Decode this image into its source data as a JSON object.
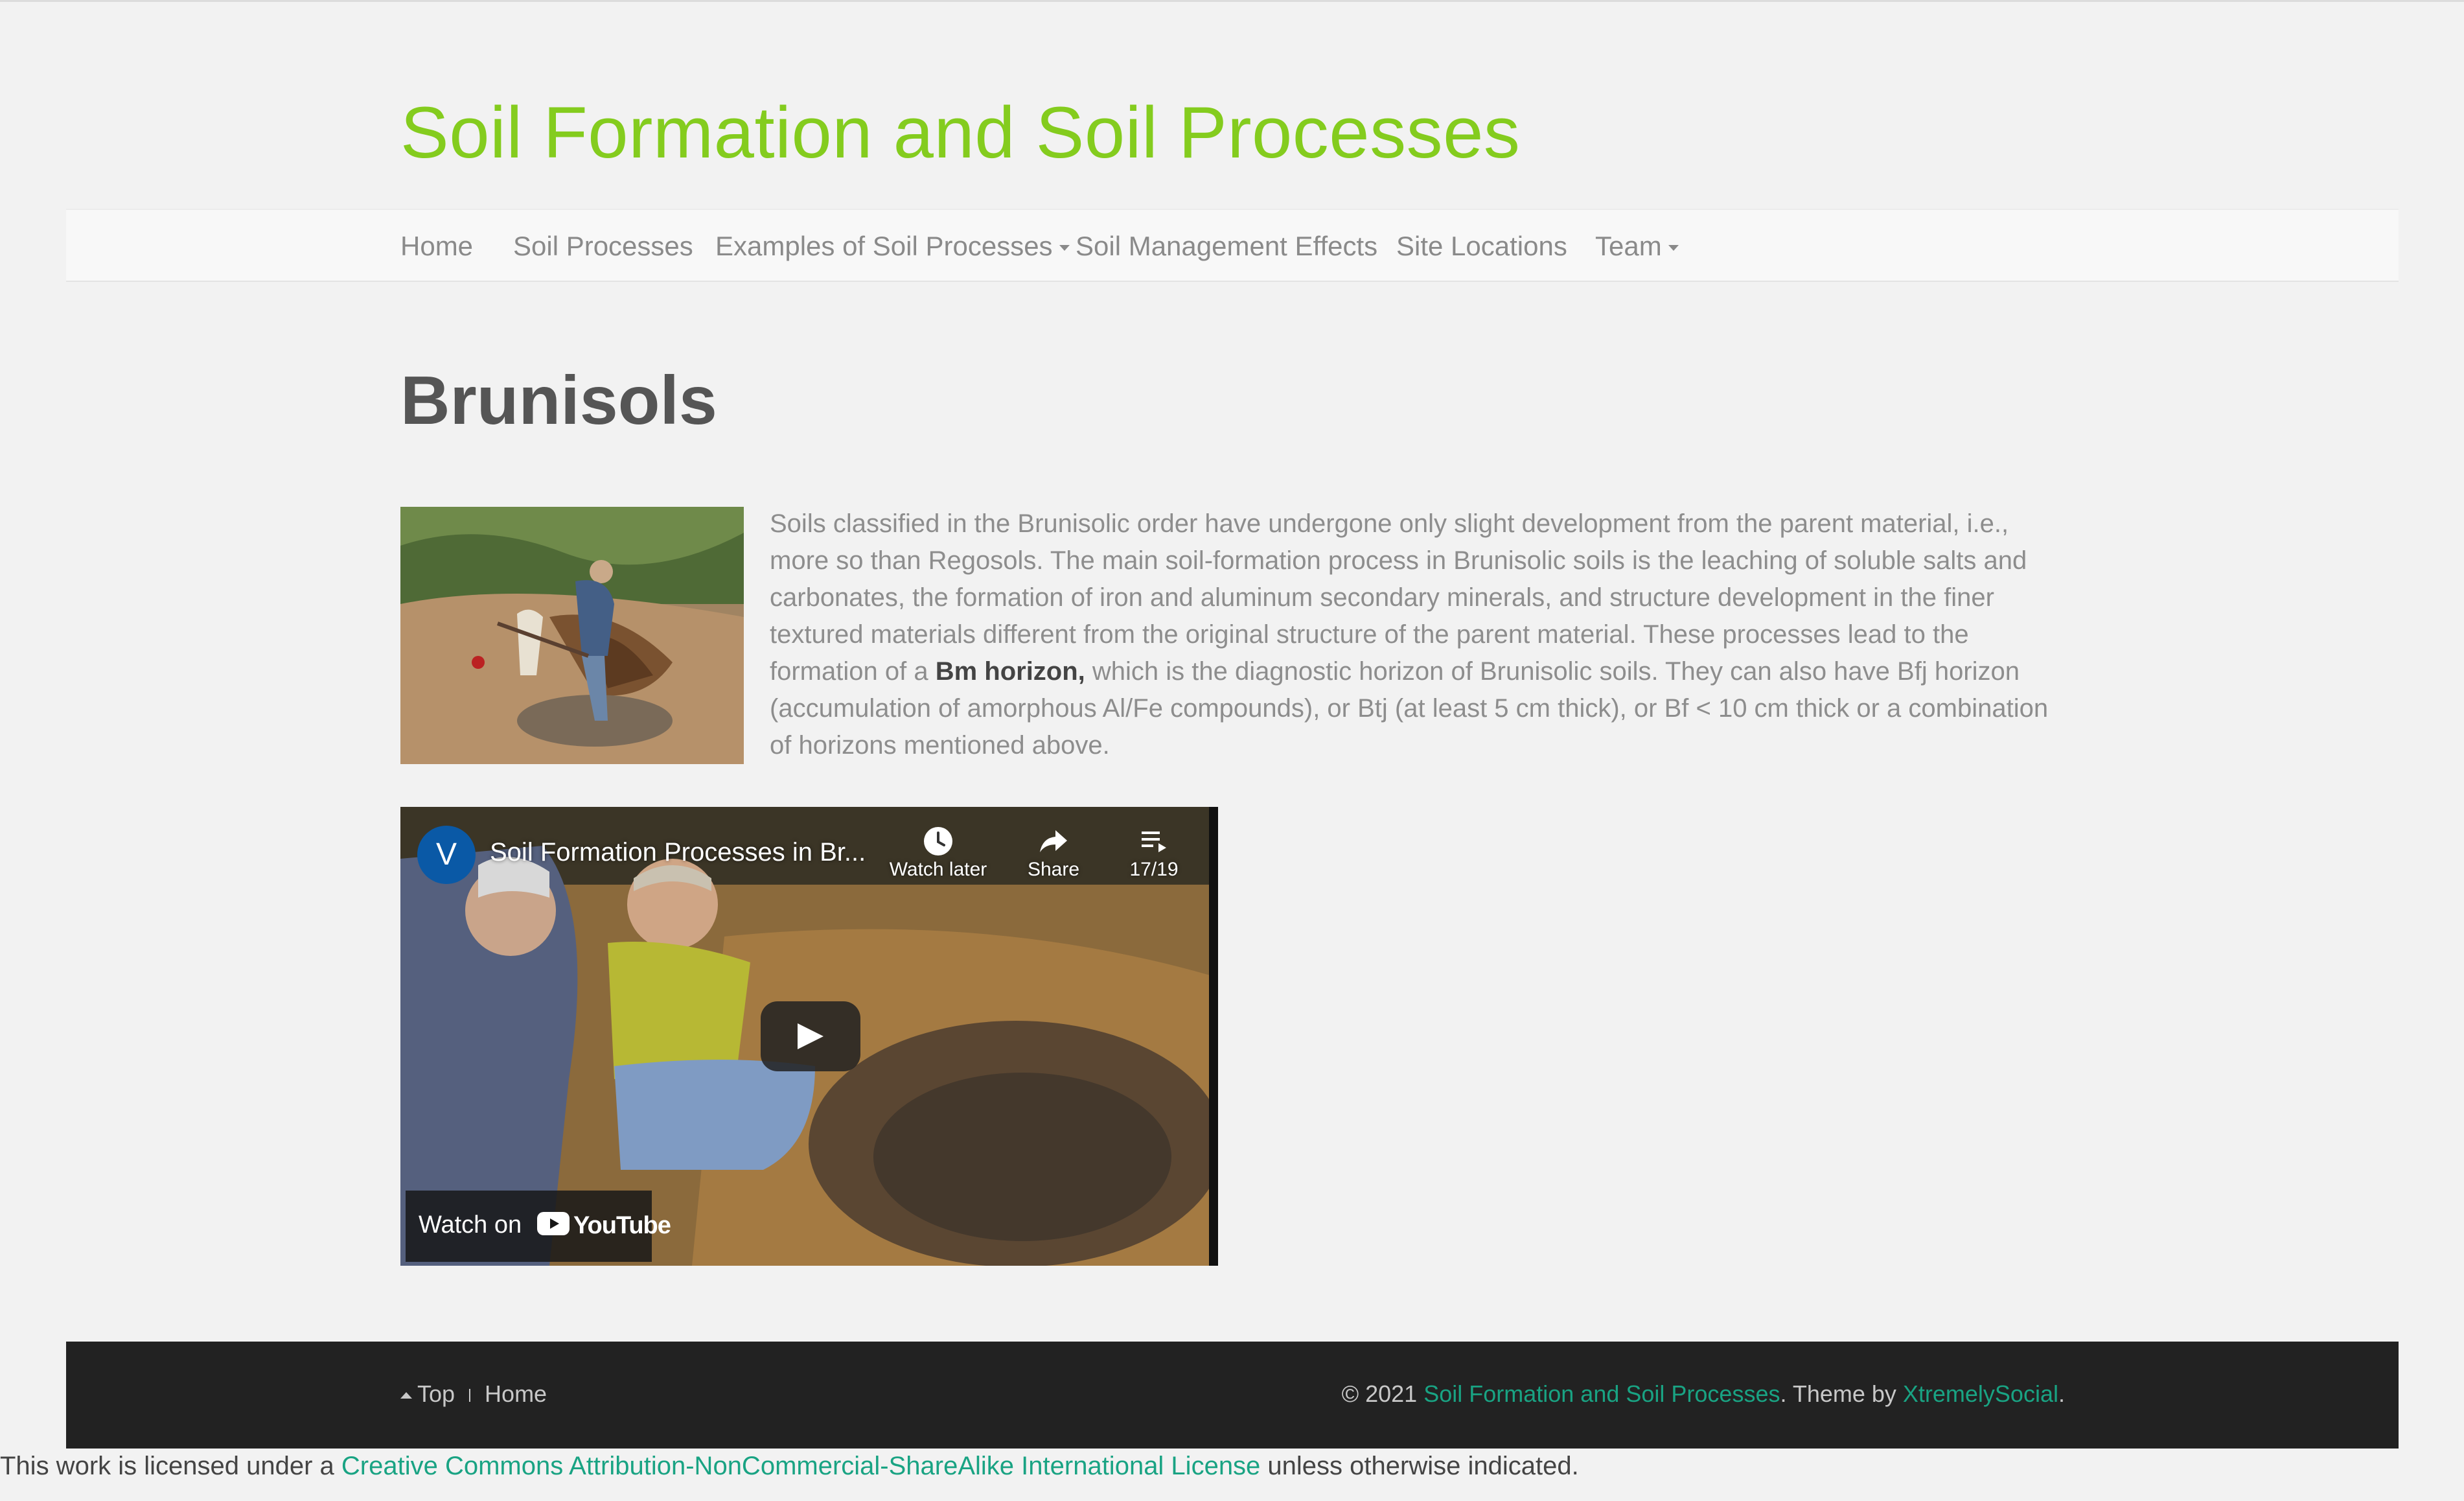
{
  "site": {
    "title": "Soil Formation and Soil Processes"
  },
  "nav": {
    "items": [
      {
        "label": "Home"
      },
      {
        "label": "Soil Processes"
      },
      {
        "label": "Examples of Soil Processes"
      },
      {
        "label": "Soil Management Effects"
      },
      {
        "label": "Site Locations"
      },
      {
        "label": "Team"
      }
    ]
  },
  "page": {
    "title": "Brunisols",
    "body_before_bold": "Soils classified in the Brunisolic order have undergone only slight development from the parent material, i.e., more so than Regosols. The main soil-formation process in Brunisolic soils is the leaching of soluble salts and carbonates, the formation of iron and aluminum secondary minerals, and structure development in the finer textured materials different from the original structure of the parent material. These processes lead to the formation of a ",
    "body_bold": "Bm horizon,",
    "body_after_bold": " which is the diagnostic horizon of Brunisolic soils. They can also have Bfj horizon (accumulation of amorphous Al/Fe compounds), or Btj (at least 5 cm thick), or Bf < 10 cm thick or a combination of horizons mentioned above."
  },
  "video": {
    "channel_initial": "V",
    "title": "Soil Formation Processes in Br...",
    "watch_later": "Watch later",
    "share": "Share",
    "playlist_position": "17/19",
    "watch_on": "Watch on",
    "youtube_word": "YouTube"
  },
  "footer": {
    "top_label": "Top",
    "home_label": "Home",
    "copyright_prefix": "© 2021 ",
    "copyright_site": "Soil Formation and Soil Processes",
    "theme_by": ". Theme by ",
    "theme_name": "XtremelySocial",
    "theme_suffix": "."
  },
  "license": {
    "prefix": "This work is licensed under a ",
    "link": "Creative Commons Attribution-NonCommercial-ShareAlike International License",
    "suffix": " unless otherwise indicated."
  },
  "colors": {
    "accent_green": "#84cc1e",
    "link_teal": "#19a383",
    "footer_bg": "#222222",
    "page_bg": "#f2f2f2"
  }
}
